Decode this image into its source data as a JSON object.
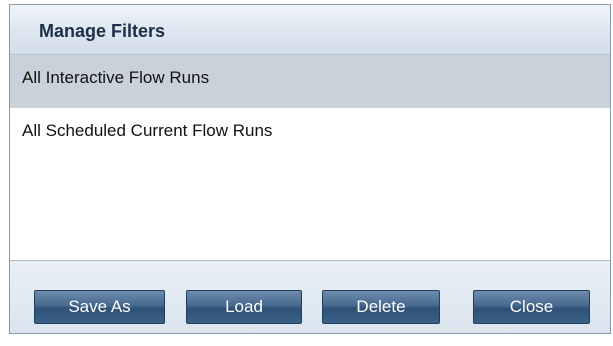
{
  "dialog": {
    "title": "Manage Filters"
  },
  "filters": [
    {
      "label": "All Interactive Flow Runs",
      "selected": true
    },
    {
      "label": "All Scheduled Current Flow Runs",
      "selected": false
    }
  ],
  "buttons": {
    "save_as": "Save As",
    "load": "Load",
    "delete": "Delete",
    "close": "Close"
  },
  "colors": {
    "selected_row": "#c9d1db",
    "button": "#3a5f88",
    "title_text": "#1c2f48"
  }
}
